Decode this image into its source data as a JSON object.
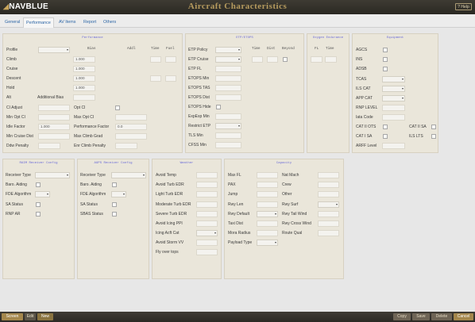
{
  "app": {
    "logo_nav": "NAV",
    "logo_blue": "BLUE",
    "title": "Aircraft Characteristics",
    "help": "? Help"
  },
  "tabs": [
    "General",
    "Performance",
    "AV Items",
    "Report",
    "Others"
  ],
  "perf": {
    "title": "Performance",
    "hdr_bias": "Bias",
    "hdr_addl": "Addl",
    "hdr_time": "Time",
    "hdr_fuel": "Fuel",
    "profile": "Profile",
    "climb": "Climb",
    "cruise": "Cruise",
    "descent": "Descent",
    "hold": "Hold",
    "alt": "Alt",
    "additional_bias": "Additional Bias",
    "climb_bias": "1.000",
    "cruise_bias": "1.000",
    "descent_bias": "1.000",
    "hold_bias": "1.000",
    "ci_adjust": "CI Adjust",
    "opt_ci": "Opt CI",
    "min_opt_ci": "Min Opt CI",
    "max_opt_ci": "Max Opt CI",
    "idle_factor": "Idle Factor",
    "idle_factor_val": "1.000",
    "perf_factor": "Performance Factor",
    "perf_factor_val": "0.0",
    "min_cruise_dist": "Min Cruise Dist",
    "max_climb_grad": "Max Climb Grad",
    "ddw_penalty": "Ddw Penalty",
    "enr_climb_penalty": "Enr Climb Penalty"
  },
  "etp": {
    "title": "ETP/ETOPS",
    "hdr_time": "Time",
    "hdr_dist": "Dist",
    "hdr_beyond": "Beyond",
    "etp_policy": "ETP Policy",
    "etp_cruise": "ETP Cruise",
    "etp_fl": "ETP FL",
    "etops_min": "ETOPS Min",
    "etops_tas": "ETOPS TAS",
    "etops_dist": "ETOPS Dist",
    "etops_hide": "ETOPS Hide",
    "expexp_min": "ExpExp Min",
    "restrict_etp": "Restrict ETP",
    "tls_min": "TLS Min",
    "cfss_min": "CFSS Min"
  },
  "oxygen": {
    "title": "Oxygen Endurance",
    "hdr_fl": "FL",
    "hdr_time": "Time"
  },
  "equipment": {
    "title": "Equipment",
    "agcs": "AGCS",
    "ins": "INS",
    "adsb": "ADSB",
    "tcas": "TCAS",
    "ils_cat": "ILS CAT",
    "app_cat": "APP CAT",
    "rnp_level": "RNP LEVEL",
    "iata_code": "Iata Code",
    "cat2_ots": "CAT II OTS",
    "cat2_sa": "CAT II SA",
    "cat1_sa": "CAT I SA",
    "ils_lts": "ILS LTS",
    "arff_level": "ARFF Level"
  },
  "raim": {
    "title": "RAIM Receiver Config",
    "receiver_type": "Receiver Type",
    "baro_aiding": "Baro. Aiding",
    "fde_algorithm": "FDE Algorithm",
    "sa_status": "SA Status",
    "rnp_ar": "RNP AR"
  },
  "agps": {
    "title": "AGPS Receiver Config",
    "receiver_type": "Receiver Type",
    "baro_aiding": "Baro. Aiding",
    "fde_algorithm": "FDE Algorithm",
    "sa_status": "SA Status",
    "sbas_status": "SBAS Status"
  },
  "weather": {
    "title": "Weather",
    "avoid_temp": "Avoid Temp",
    "avoid_turb_edr": "Avoid Turb EDR",
    "light_turb_edr": "Light Turb EDR",
    "moderate_turb_edr": "Moderate Turb EDR",
    "severe_turb_edr": "Severe Turb EDR",
    "avoid_icing_ppi": "Avoid Icing PPI",
    "icing_acft_cat": "Icing Acft Cat",
    "avoid_storm_vv": "Avoid Storm VV",
    "fly_over_tops": "Fly over tops"
  },
  "capacity": {
    "title": "Capacity",
    "max_fl": "Max FL",
    "pax": "PAX",
    "jump": "Jump",
    "rwy_len": "Rwy Len",
    "rwy_default": "Rwy Default",
    "taxi_dist": "Taxi Dist",
    "mora_radius": "Mora Radius",
    "payload_type": "Payload Type",
    "nat_mach": "Nat Mach",
    "crew": "Crew",
    "other": "Other",
    "rwy_surf": "Rwy Surf",
    "rwy_tail_wind": "Rwy Tail Wind",
    "rwy_cross_wind": "Rwy Cross Wind",
    "route_qual": "Route Qual"
  },
  "footer": {
    "screen": "Screen",
    "edit": "Edit",
    "new": "New",
    "copy": "Copy",
    "save": "Save",
    "delete": "Delete",
    "cancel": "Cancel"
  },
  "icons": {
    "dropdown": "chevron-down-icon",
    "checkbox": "checkbox-icon"
  }
}
